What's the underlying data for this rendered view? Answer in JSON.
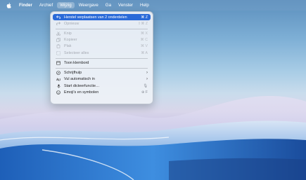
{
  "menubar": {
    "app_name": "Finder",
    "items": [
      "Archief",
      "Wijzig",
      "Weergave",
      "Ga",
      "Venster",
      "Help"
    ]
  },
  "edit_menu": {
    "undo": {
      "label": "Herstel verplaatsen van 2 onderdelen",
      "shortcut": "⌘ Z"
    },
    "redo": {
      "label": "Opnieuw",
      "shortcut": "⇧⌘ Z"
    },
    "cut": {
      "label": "Knip",
      "shortcut": "⌘ X"
    },
    "copy": {
      "label": "Kopieer",
      "shortcut": "⌘ C"
    },
    "paste": {
      "label": "Plak",
      "shortcut": "⌘ V"
    },
    "select_all": {
      "label": "Selecteer alles",
      "shortcut": "⌘ A"
    },
    "show_clipboard": {
      "label": "Toon klembord"
    },
    "writing_tools": {
      "label": "Schrijfhulp"
    },
    "autofill": {
      "label": "Vul automatisch in"
    },
    "dictation": {
      "label": "Start dicteerfunctie…",
      "shortcut": "🎙"
    },
    "emoji": {
      "label": "Emoji's en symbolen",
      "shortcut": "⊕ F"
    }
  },
  "colors": {
    "highlight": "#2a6ad8",
    "menu_bg": "#eef1f6"
  }
}
